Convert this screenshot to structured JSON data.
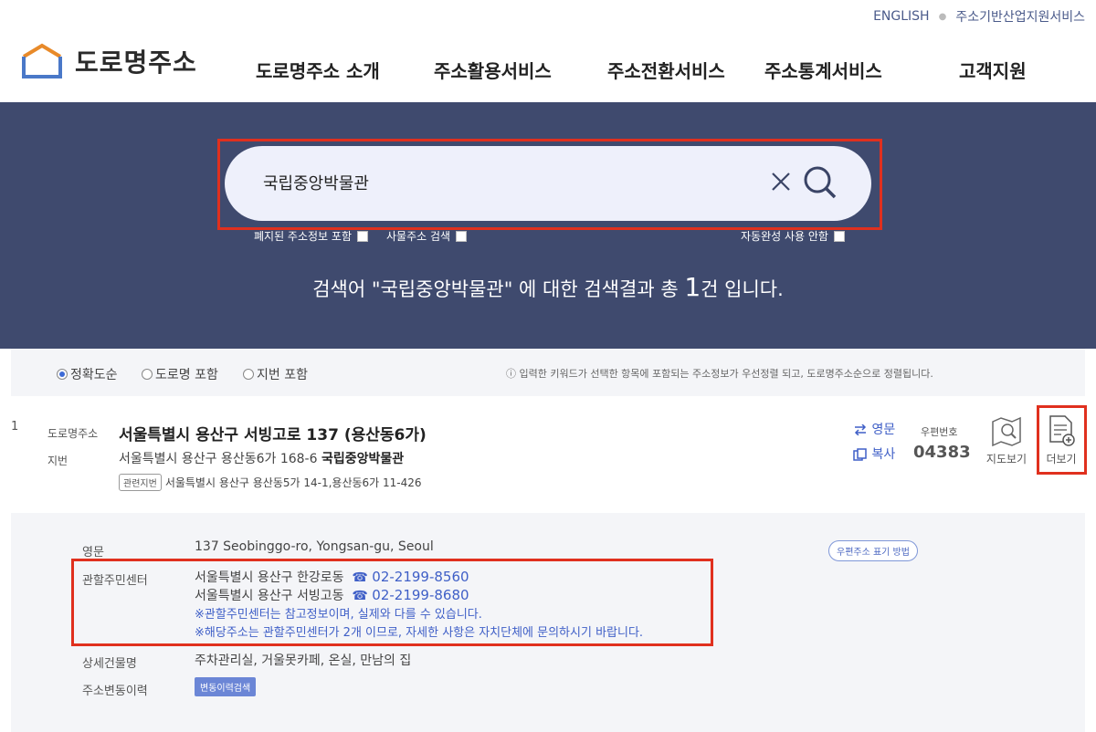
{
  "util_links": [
    "ENGLISH",
    "주소기반산업지원서비스"
  ],
  "logo_text": "도로명주소",
  "nav": [
    "도로명주소 소개",
    "주소활용서비스",
    "주소전환서비스",
    "주소통계서비스",
    "고객지원"
  ],
  "search": {
    "query": "국립중앙박물관"
  },
  "options": [
    "폐지된 주소정보 포함",
    "사물주소 검색",
    "자동완성 사용 안함"
  ],
  "summary": {
    "pre": "검색어 \"국립중앙박물관\" 에 대한 검색결과 총 ",
    "count": "1",
    "post": "건 입니다."
  },
  "sort": {
    "options": [
      "정확도순",
      "도로명 포함",
      "지번 포함"
    ],
    "selected": "정확도순",
    "note": "ⓘ 입력한 키워드가 선택한 항목에 포함되는 주소정보가 우선정렬 되고, 도로명주소순으로 정렬됩니다."
  },
  "result": {
    "index": "1",
    "road_label": "도로명주소",
    "road_addr": "서울특별시 용산구 서빙고로 137 (용산동6가)",
    "jibun_label": "지번",
    "jibun_addr": "서울특별시 용산구 용산동6가 168-6",
    "building": "국립중앙박물관",
    "related_tag": "관련지번",
    "related": "서울특별시 용산구 용산동5가 14-1,용산동6가 11-426",
    "english_btn": "영문",
    "copy_btn": "복사",
    "postal_label": "우편번호",
    "postal": "04383",
    "map_btn": "지도보기",
    "more_btn": "더보기"
  },
  "detail": {
    "eng_label": "영문",
    "eng_value": "137 Seobinggo-ro, Yongsan-gu, Seoul",
    "postal_guide": "우편주소 표기 방법",
    "center_label": "관할주민센터",
    "centers": [
      {
        "name": "서울특별시 용산구 한강로동",
        "phone": "02-2199-8560"
      },
      {
        "name": "서울특별시 용산구 서빙고동",
        "phone": "02-2199-8680"
      }
    ],
    "notes": [
      "※관할주민센터는 참고정보이며, 실제와 다를 수 있습니다.",
      "※해당주소는 관할주민센터가 2개 이므로, 자세한 사항은 자치단체에 문의하시기 바랍니다."
    ],
    "bldg_label": "상세건물명",
    "bldg_value": "주차관리실, 거울못카페, 온실, 만남의 집",
    "history_label": "주소변동이력",
    "history_btn": "변동이력검색"
  },
  "colors": {
    "hero_bg": "#3f4a6e",
    "highlight": "#e0301e",
    "link_blue": "#3f5fc7"
  }
}
